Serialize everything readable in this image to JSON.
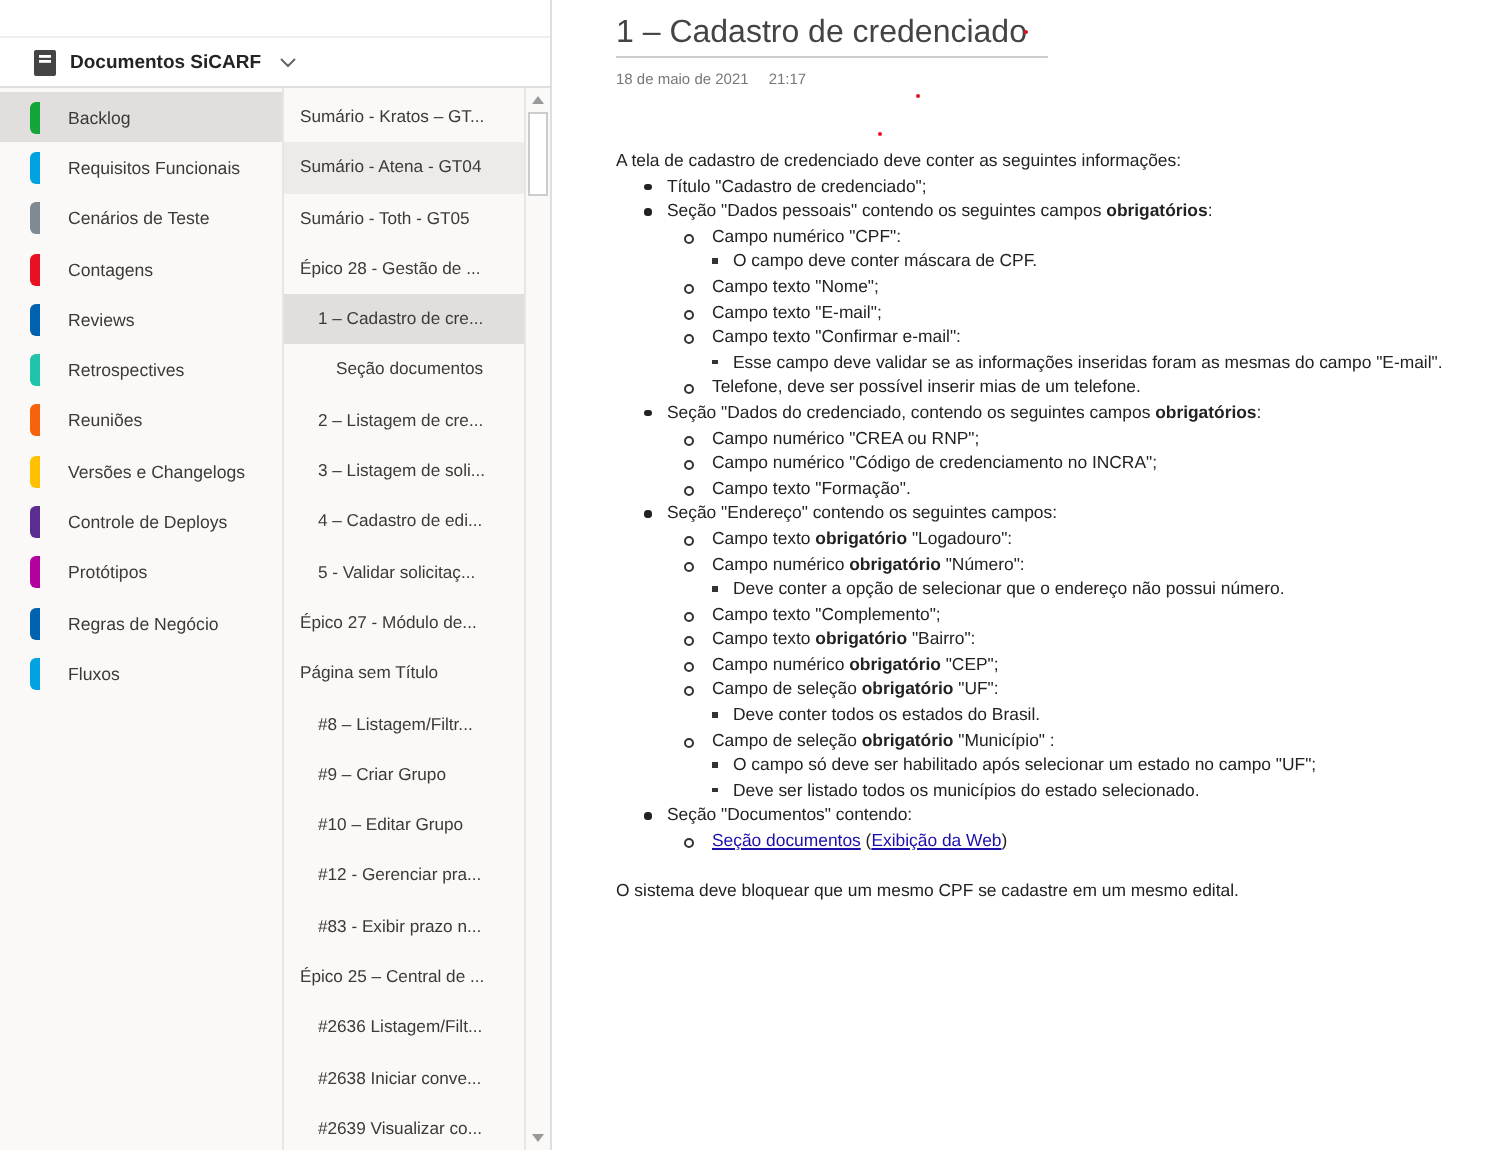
{
  "notebook": {
    "title": "Documentos SiCARF"
  },
  "sections": [
    {
      "label": "Backlog",
      "color": "#13a538",
      "selected": true
    },
    {
      "label": "Requisitos Funcionais",
      "color": "#00a3e0",
      "selected": false
    },
    {
      "label": "Cenários de Teste",
      "color": "#7f8a93",
      "selected": false
    },
    {
      "label": "Contagens",
      "color": "#e81123",
      "selected": false
    },
    {
      "label": "Reviews",
      "color": "#0063b1",
      "selected": false
    },
    {
      "label": "Retrospectives",
      "color": "#20c4a8",
      "selected": false
    },
    {
      "label": "Reuniões",
      "color": "#f7630c",
      "selected": false
    },
    {
      "label": "Versões e Changelogs",
      "color": "#ffc000",
      "selected": false
    },
    {
      "label": "Controle de Deploys",
      "color": "#5c2d91",
      "selected": false
    },
    {
      "label": "Protótipos",
      "color": "#b4009e",
      "selected": false
    },
    {
      "label": "Regras de Negócio",
      "color": "#0063b1",
      "selected": false
    },
    {
      "label": "Fluxos",
      "color": "#00a3e0",
      "selected": false
    }
  ],
  "pages": [
    {
      "label": "Sumário - Kratos – GT...",
      "selected": false,
      "hovered": false
    },
    {
      "label": "Sumário - Atena - GT04",
      "selected": false,
      "hovered": true
    },
    {
      "label": "Sumário - Toth - GT05",
      "selected": false,
      "hovered": false
    },
    {
      "label": "Épico 28 - Gestão de ...",
      "selected": false,
      "hovered": false,
      "children": [
        {
          "label": "1 – Cadastro de cre...",
          "selected": true,
          "hovered": false,
          "children": [
            {
              "label": "Seção documentos",
              "selected": false,
              "hovered": false
            }
          ]
        },
        {
          "label": "2 – Listagem de cre...",
          "selected": false,
          "hovered": false
        },
        {
          "label": "3 – Listagem de soli...",
          "selected": false,
          "hovered": false
        },
        {
          "label": "4 – Cadastro de edi...",
          "selected": false,
          "hovered": false
        },
        {
          "label": "5 - Validar solicitaç...",
          "selected": false,
          "hovered": false
        }
      ]
    },
    {
      "label": "Épico 27 - Módulo de...",
      "selected": false,
      "hovered": false
    },
    {
      "label": "Página sem Título",
      "selected": false,
      "hovered": false,
      "children": [
        {
          "label": "#8 – Listagem/Filtr...",
          "selected": false,
          "hovered": false
        },
        {
          "label": "#9 – Criar Grupo",
          "selected": false,
          "hovered": false
        },
        {
          "label": "#10 – Editar Grupo",
          "selected": false,
          "hovered": false
        },
        {
          "label": "#12 - Gerenciar pra...",
          "selected": false,
          "hovered": false
        },
        {
          "label": "#83 - Exibir prazo n...",
          "selected": false,
          "hovered": false
        }
      ]
    },
    {
      "label": "Épico 25 – Central de ...",
      "selected": false,
      "hovered": false,
      "children": [
        {
          "label": "#2636 Listagem/Filt...",
          "selected": false,
          "hovered": false
        },
        {
          "label": "#2638 Iniciar conve...",
          "selected": false,
          "hovered": false
        },
        {
          "label": "#2639 Visualizar co...",
          "selected": false,
          "hovered": false
        }
      ]
    }
  ],
  "page": {
    "title": "1 – Cadastro de credenciado",
    "date": "18 de maio de 2021",
    "time": "21:17",
    "intro": "A tela de cadastro de credenciado deve conter as seguintes informações:",
    "items": [
      {
        "text": "Título \"Cadastro de credenciado\";"
      },
      {
        "text": "Seção \"Dados pessoais\" contendo os seguintes campos **obrigatórios**:",
        "children": [
          {
            "text": "Campo numérico \"CPF\":",
            "children": [
              {
                "text": "O campo deve conter máscara de CPF."
              }
            ]
          },
          {
            "text": "Campo texto \"Nome\";"
          },
          {
            "text": "Campo texto \"E-mail\";"
          },
          {
            "text": "Campo texto \"Confirmar e-mail\":",
            "children": [
              {
                "text": "Esse campo deve validar se as informações inseridas foram as mesmas do campo \"E-mail\"."
              }
            ]
          },
          {
            "text": "Telefone, deve ser possível inserir mias de um telefone."
          }
        ]
      },
      {
        "text": "Seção \"Dados do credenciado, contendo os seguintes campos **obrigatórios**:",
        "children": [
          {
            "text": "Campo numérico \"CREA ou RNP\";"
          },
          {
            "text": "Campo numérico \"Código de credenciamento no INCRA\";"
          },
          {
            "text": "Campo texto \"Formação\"."
          }
        ]
      },
      {
        "text": "Seção \"Endereço\" contendo os seguintes campos:",
        "children": [
          {
            "text": "Campo texto **obrigatório** \"Logadouro\":"
          },
          {
            "text": "Campo numérico **obrigatório** \"Número\":",
            "children": [
              {
                "text": "Deve conter a opção de selecionar que o endereço não possui número."
              }
            ]
          },
          {
            "text": "Campo texto \"Complemento\";"
          },
          {
            "text": "Campo texto **obrigatório** \"Bairro\":"
          },
          {
            "text": "Campo numérico **obrigatório** \"CEP\";"
          },
          {
            "text": "Campo de seleção **obrigatório** \"UF\":",
            "children": [
              {
                "text": "Deve conter todos os estados do Brasil."
              }
            ]
          },
          {
            "text": "Campo de seleção **obrigatório** \"Município\" :",
            "children": [
              {
                "text": "O campo só deve ser habilitado após selecionar um estado no campo \"UF\";"
              },
              {
                "text": "Deve ser listado todos os municípios do estado selecionado."
              }
            ]
          }
        ]
      },
      {
        "text": "Seção \"Documentos\" contendo:",
        "children": [
          {
            "kind": "links",
            "parts": [
              {
                "text": "Seção documentos",
                "link": true
              },
              {
                "text": "(",
                "link": false
              },
              {
                "text": "Exibição da Web",
                "link": true
              },
              {
                "text": ")",
                "link": false
              }
            ]
          }
        ]
      }
    ],
    "closing": "O sistema deve bloquear que um mesmo CPF se cadastre em um mesmo edital."
  }
}
